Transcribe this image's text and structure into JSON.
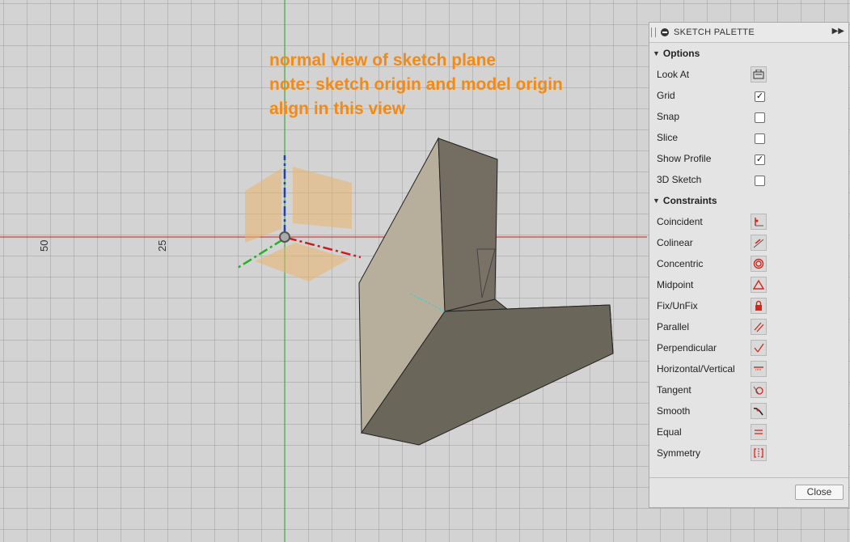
{
  "viewport": {
    "annotation": {
      "line1": "normal view of sketch plane",
      "line2": "note: sketch origin and model origin",
      "line3": "align in this view"
    },
    "ruler": {
      "label_a": "50",
      "label_b": "25"
    }
  },
  "palette": {
    "title": "SKETCH PALETTE",
    "options_header": "Options",
    "options": [
      {
        "label": "Look At",
        "type": "button",
        "icon": "look-at-icon"
      },
      {
        "label": "Grid",
        "type": "checkbox",
        "checked": true
      },
      {
        "label": "Snap",
        "type": "checkbox",
        "checked": false
      },
      {
        "label": "Slice",
        "type": "checkbox",
        "checked": false
      },
      {
        "label": "Show Profile",
        "type": "checkbox",
        "checked": true
      },
      {
        "label": "3D Sketch",
        "type": "checkbox",
        "checked": false
      }
    ],
    "constraints_header": "Constraints",
    "constraints": [
      {
        "label": "Coincident",
        "icon": "coincident-icon"
      },
      {
        "label": "Colinear",
        "icon": "colinear-icon"
      },
      {
        "label": "Concentric",
        "icon": "concentric-icon"
      },
      {
        "label": "Midpoint",
        "icon": "midpoint-icon"
      },
      {
        "label": "Fix/UnFix",
        "icon": "lock-icon"
      },
      {
        "label": "Parallel",
        "icon": "parallel-icon"
      },
      {
        "label": "Perpendicular",
        "icon": "perpendicular-icon"
      },
      {
        "label": "Horizontal/Vertical",
        "icon": "horizontal-vertical-icon"
      },
      {
        "label": "Tangent",
        "icon": "tangent-icon"
      },
      {
        "label": "Smooth",
        "icon": "smooth-icon"
      },
      {
        "label": "Equal",
        "icon": "equal-icon"
      },
      {
        "label": "Symmetry",
        "icon": "symmetry-icon"
      }
    ],
    "close_label": "Close"
  },
  "colors": {
    "annotation": "#f28a13",
    "x_axis": "#d11b1b",
    "y_axis": "#1fb21f",
    "z_axis": "#1f3fb8",
    "constraint_icon": "#d0281e",
    "model_face_light": "#b9b0a0",
    "model_face_dark": "#7a7364"
  }
}
